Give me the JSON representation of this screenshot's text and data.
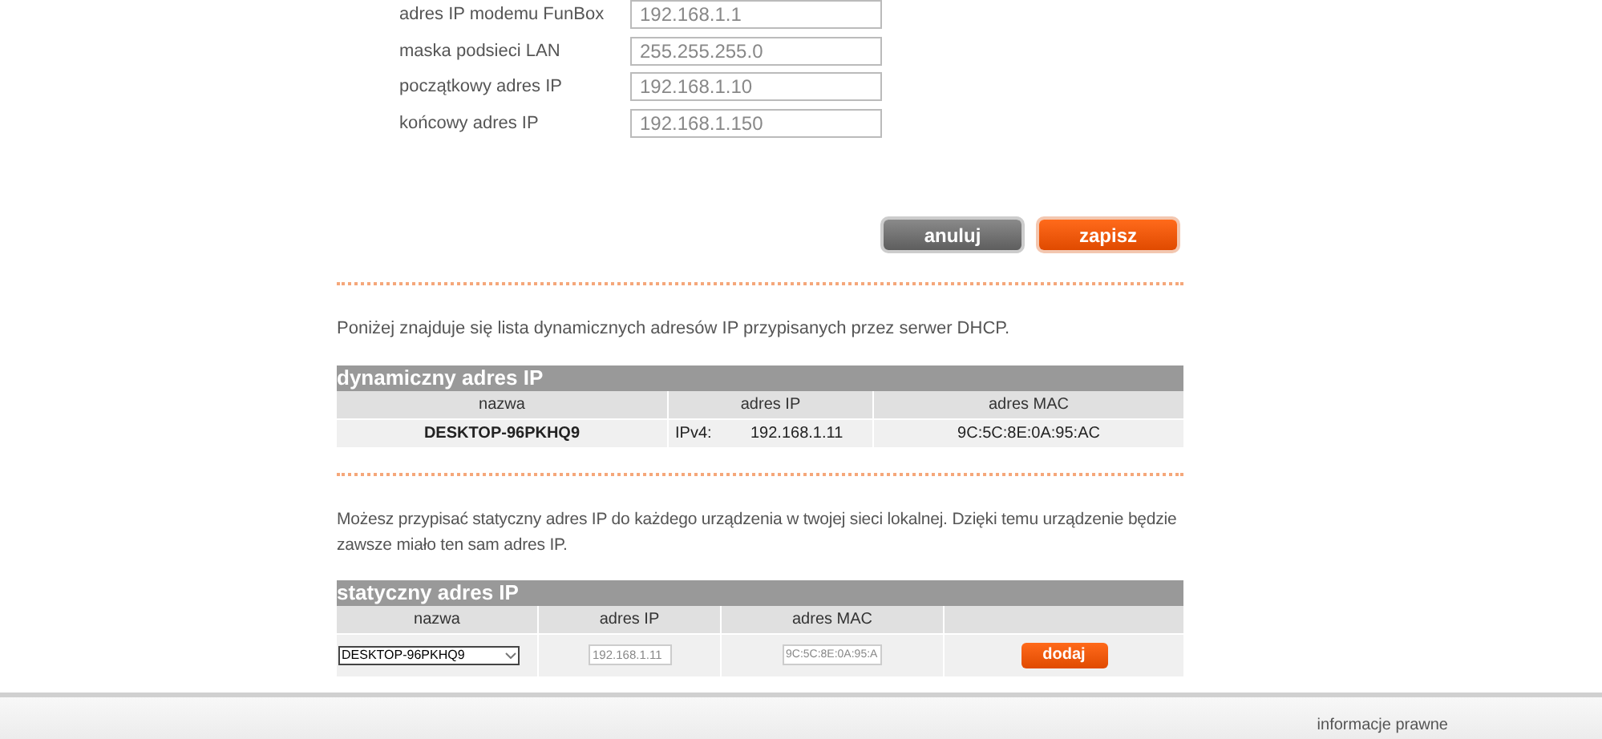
{
  "form": {
    "fields": [
      {
        "label": "adres IP modemu FunBox",
        "value": "192.168.1.1"
      },
      {
        "label": "maska podsieci LAN",
        "value": "255.255.255.0"
      },
      {
        "label": "początkowy adres IP",
        "value": "192.168.1.10"
      },
      {
        "label": "końcowy adres IP",
        "value": "192.168.1.150"
      }
    ],
    "buttons": [
      {
        "label": "anuluj",
        "kind": "secondary"
      },
      {
        "label": "zapisz",
        "kind": "primary"
      }
    ]
  },
  "dynamic": {
    "intro": "Poniżej znajduje się lista dynamicznych adresów IP przypisanych przez serwer DHCP.",
    "title": "dynamiczny adres IP",
    "columns": [
      "nazwa",
      "adres IP",
      "adres MAC"
    ],
    "rows": [
      {
        "name": "DESKTOP-96PKHQ9",
        "ip_type": "IPv4:",
        "ip": "192.168.1.11",
        "mac": "9C:5C:8E:0A:95:AC"
      }
    ]
  },
  "static": {
    "intro": "Możesz przypisać statyczny adres IP do każdego urządzenia w twojej sieci lokalnej. Dzięki temu urządzenie będzie zawsze miało ten sam adres IP.",
    "title": "statyczny adres IP",
    "columns": [
      "nazwa",
      "adres IP",
      "adres MAC"
    ],
    "row": {
      "device": "DESKTOP-96PKHQ9",
      "ip": "192.168.1.11",
      "mac": "9C:5C:8E:0A:95:A",
      "button": "dodaj"
    }
  },
  "footer": {
    "link": "informacje prawne"
  }
}
